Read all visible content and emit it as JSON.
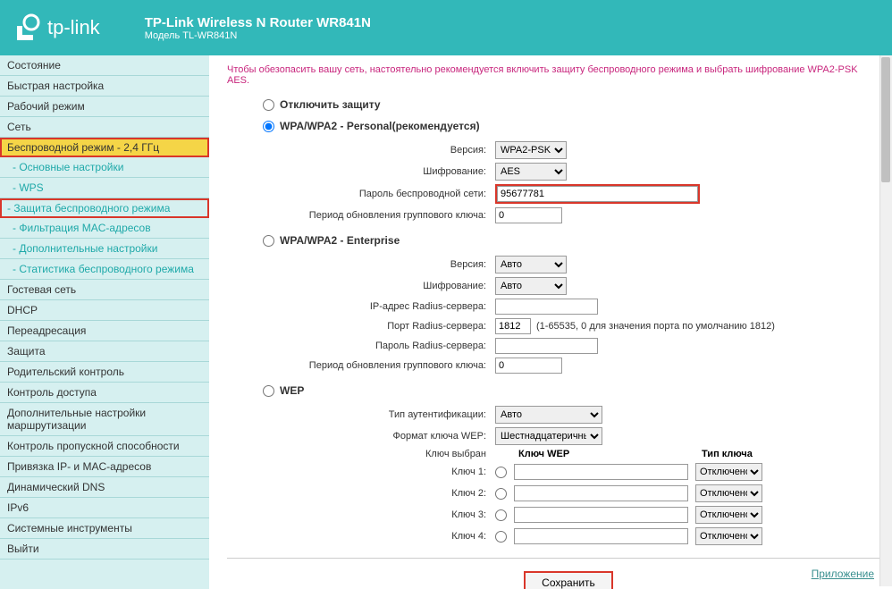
{
  "header": {
    "brand": "tp-link",
    "title": "TP-Link Wireless N Router WR841N",
    "model": "Модель TL-WR841N"
  },
  "sidebar": {
    "items": [
      {
        "label": "Состояние",
        "type": "item"
      },
      {
        "label": "Быстрая настройка",
        "type": "item"
      },
      {
        "label": "Рабочий режим",
        "type": "item"
      },
      {
        "label": "Сеть",
        "type": "item"
      },
      {
        "label": "Беспроводной режим - 2,4 ГГц",
        "type": "highlight"
      },
      {
        "label": "- Основные настройки",
        "type": "sub"
      },
      {
        "label": "- WPS",
        "type": "sub"
      },
      {
        "label": "- Защита беспроводного режима",
        "type": "sub-highlight"
      },
      {
        "label": "- Фильтрация MAC-адресов",
        "type": "sub"
      },
      {
        "label": "- Дополнительные настройки",
        "type": "sub"
      },
      {
        "label": "- Статистика беспроводного режима",
        "type": "sub"
      },
      {
        "label": "Гостевая сеть",
        "type": "item"
      },
      {
        "label": "DHCP",
        "type": "item"
      },
      {
        "label": "Переадресация",
        "type": "item"
      },
      {
        "label": "Защита",
        "type": "item"
      },
      {
        "label": "Родительский контроль",
        "type": "item"
      },
      {
        "label": "Контроль доступа",
        "type": "item"
      },
      {
        "label": "Дополнительные настройки маршрутизации",
        "type": "item"
      },
      {
        "label": "Контроль пропускной способности",
        "type": "item"
      },
      {
        "label": "Привязка IP- и MAC-адресов",
        "type": "item"
      },
      {
        "label": "Динамический DNS",
        "type": "item"
      },
      {
        "label": "IPv6",
        "type": "item"
      },
      {
        "label": "Системные инструменты",
        "type": "item"
      },
      {
        "label": "Выйти",
        "type": "item"
      }
    ]
  },
  "content": {
    "warning": "Чтобы обезопасить вашу сеть, настоятельно рекомендуется включить защиту беспроводного режима и выбрать шифрование WPA2-PSK AES.",
    "disable_label": "Отключить защиту",
    "personal": {
      "heading": "WPA/WPA2 - Personal(рекомендуется)",
      "version_label": "Версия:",
      "version_value": "WPA2-PSK",
      "encryption_label": "Шифрование:",
      "encryption_value": "AES",
      "password_label": "Пароль беспроводной сети:",
      "password_value": "95677781",
      "group_key_label": "Период обновления группового ключа:",
      "group_key_value": "0"
    },
    "enterprise": {
      "heading": "WPA/WPA2 - Enterprise",
      "version_label": "Версия:",
      "version_value": "Авто",
      "encryption_label": "Шифрование:",
      "encryption_value": "Авто",
      "radius_ip_label": "IP-адрес Radius-сервера:",
      "radius_ip_value": "",
      "radius_port_label": "Порт Radius-сервера:",
      "radius_port_value": "1812",
      "radius_port_hint": "(1-65535, 0 для значения порта по умолчанию 1812)",
      "radius_pw_label": "Пароль Radius-сервера:",
      "radius_pw_value": "",
      "group_key_label": "Период обновления группового ключа:",
      "group_key_value": "0"
    },
    "wep": {
      "heading": "WEP",
      "auth_label": "Тип аутентификации:",
      "auth_value": "Авто",
      "format_label": "Формат ключа WEP:",
      "format_value": "Шестнадцатеричный",
      "selected_label": "Ключ выбран",
      "key_col": "Ключ WEP",
      "type_col": "Тип ключа",
      "keys": [
        {
          "label": "Ключ 1:",
          "value": "",
          "type": "Отключено"
        },
        {
          "label": "Ключ 2:",
          "value": "",
          "type": "Отключено"
        },
        {
          "label": "Ключ 3:",
          "value": "",
          "type": "Отключено"
        },
        {
          "label": "Ключ 4:",
          "value": "",
          "type": "Отключено"
        }
      ]
    },
    "save_label": "Сохранить",
    "app_link": "Приложение"
  }
}
